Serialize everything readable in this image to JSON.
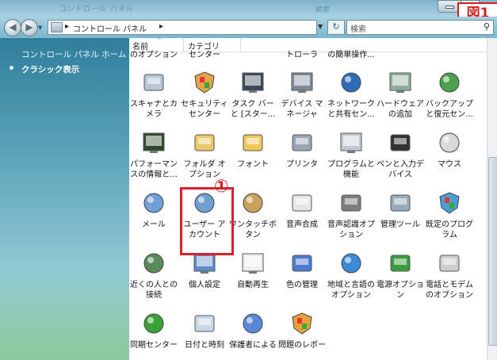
{
  "window": {
    "title_ghost": "コントロール パネル",
    "search_ghost": "検索"
  },
  "badge": "図1",
  "nav": {
    "breadcrumbs": [
      "コントロール パネル"
    ],
    "search_placeholder": "検索"
  },
  "left_pane": {
    "home_link": "コントロール パネル ホーム",
    "classic_view": "クラシック表示"
  },
  "columns": [
    "名前",
    "カテゴリ"
  ],
  "top_row_partial": [
    "のオプション",
    "センター",
    "",
    "トローラ",
    "の簡単操作..."
  ],
  "rows": [
    [
      "スキャナとカ\nメラ",
      "セキュリティ\nセンター",
      "タスク バー\nと [スター...",
      "デバイス マ\nネージャ",
      "ネットワーク\nと共有セン...",
      "ハードウェア\nの追加",
      "バックアップ\nと復元セン..."
    ],
    [
      "パフォーマン\nスの情報と...",
      "フォルダ オ\nプション",
      "フォント",
      "プリンタ",
      "プログラムと\n機能",
      "ペンと入力デ\nバイス",
      "マウス"
    ],
    [
      "メール",
      "ユーザー ア\nカウント",
      "ワンタッチボ\nタン",
      "音声合成",
      "音声認識オプ\nション",
      "管理ツール",
      "既定のプログ\nラム"
    ],
    [
      "近くの人との\n接続",
      "個人設定",
      "自動再生",
      "色の管理",
      "地域と言語の\nオプション",
      "電源オプショ\nン",
      "電話とモデム\nのオプション"
    ],
    [
      "同期センター",
      "日付と時刻",
      "保護者による",
      "問題のレポー"
    ]
  ],
  "annotation": {
    "highlighted": "ユーザー アカウント",
    "marker": "①"
  }
}
